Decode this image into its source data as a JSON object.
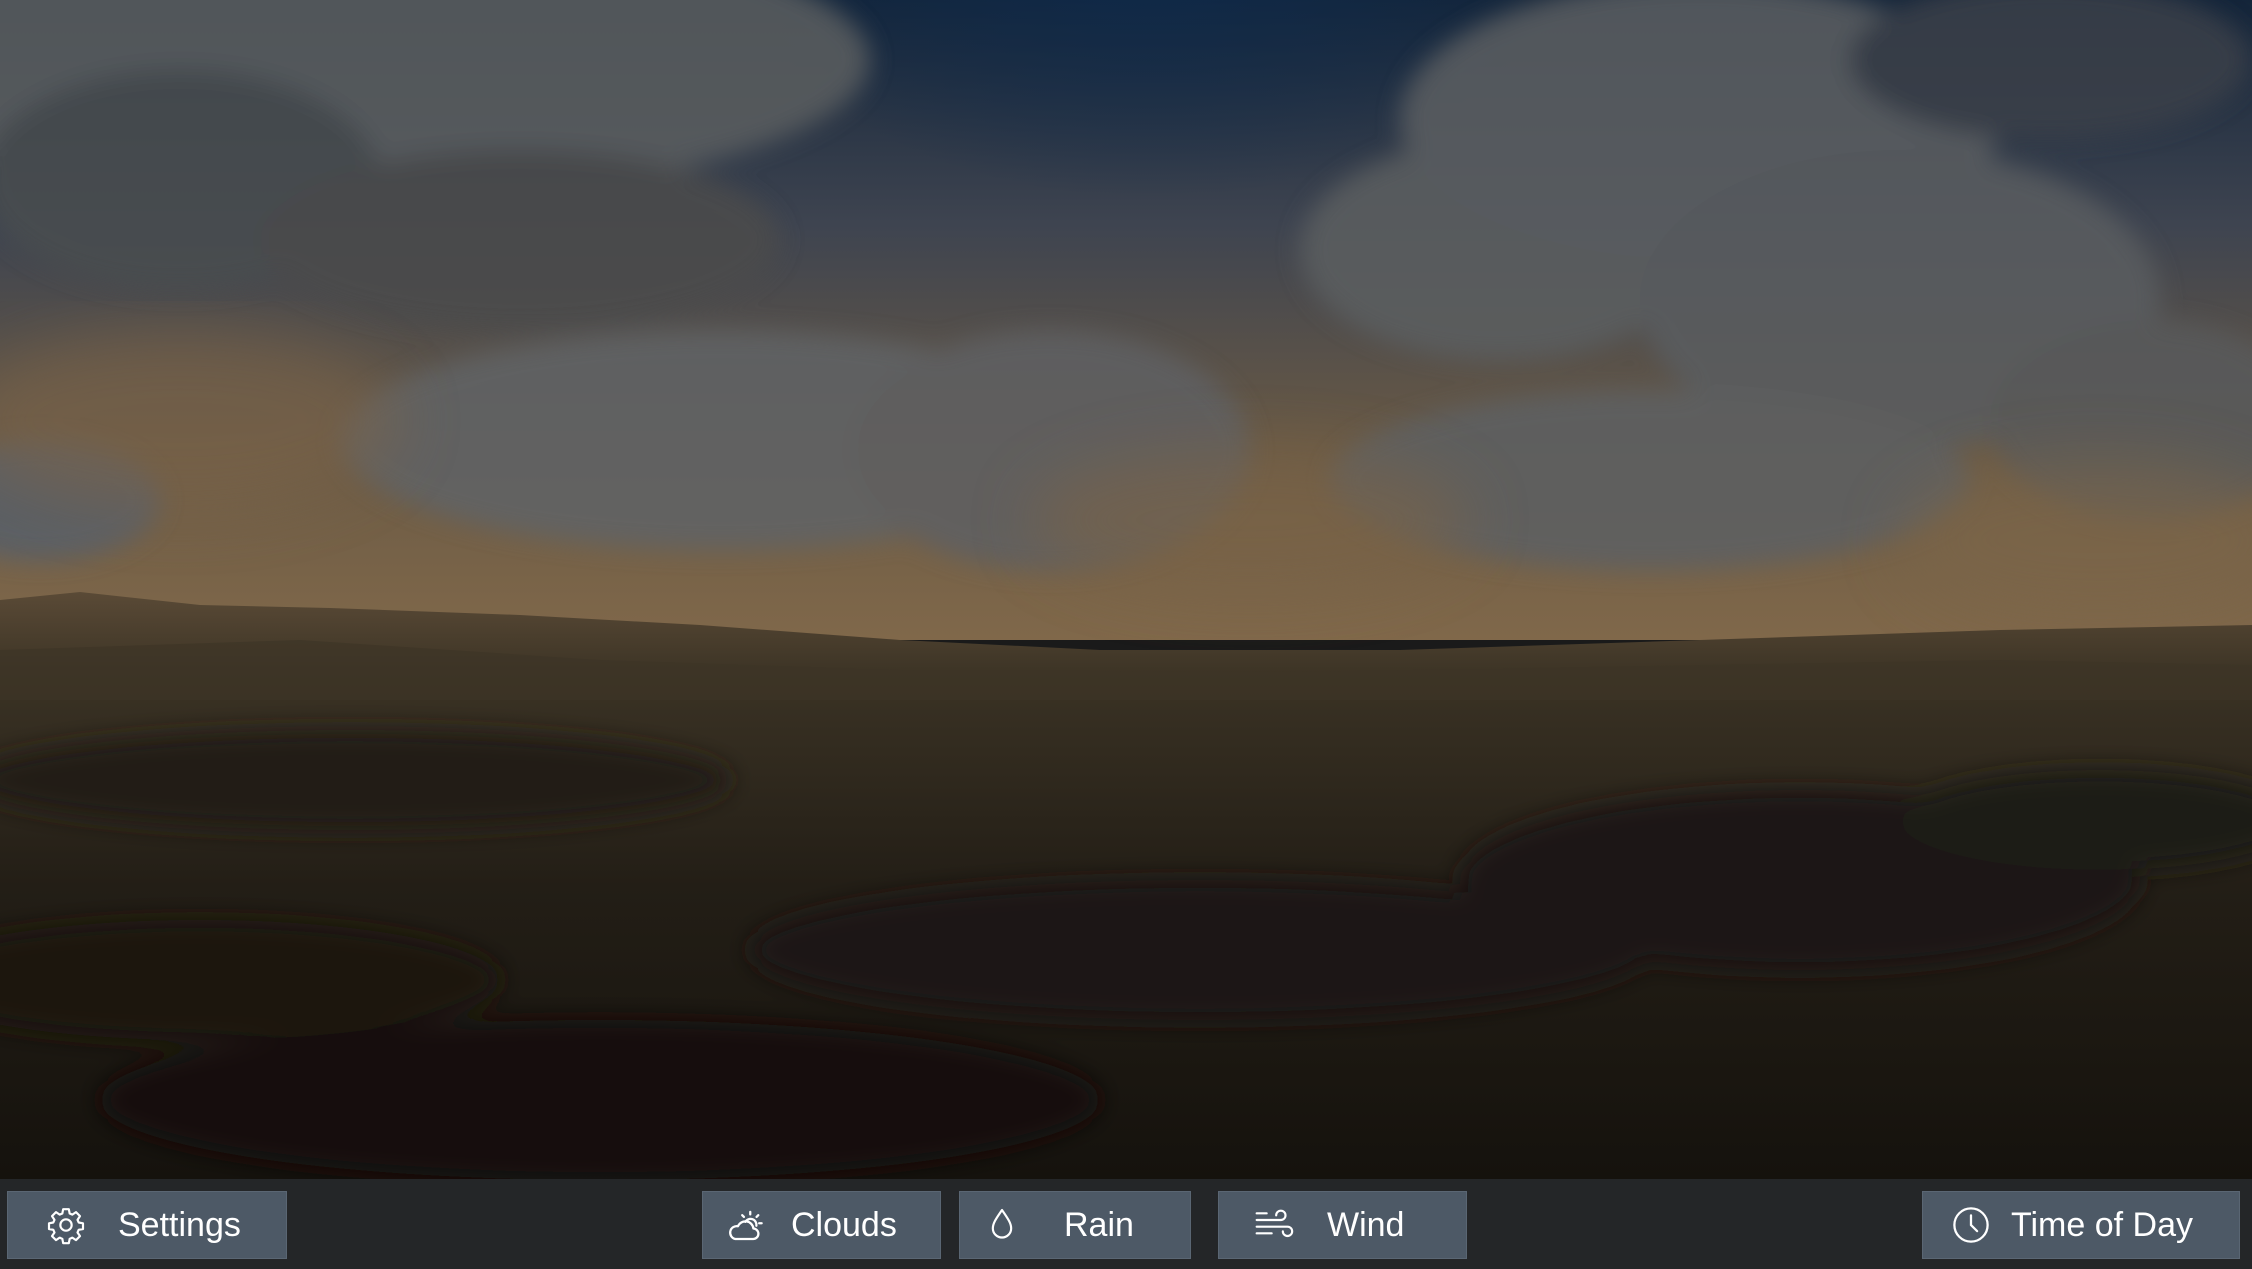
{
  "toolbar": {
    "settings": {
      "label": "Settings",
      "icon": "gear-icon"
    },
    "clouds": {
      "label": "Clouds",
      "icon": "partly-cloudy-icon"
    },
    "rain": {
      "label": "Rain",
      "icon": "raindrop-icon"
    },
    "wind": {
      "label": "Wind",
      "icon": "wind-icon"
    },
    "time_of_day": {
      "label": "Time of Day",
      "icon": "clock-icon"
    }
  },
  "colors": {
    "toolbar_background": "#242628",
    "button_background": "#4d5966",
    "button_text": "#ffffff"
  }
}
